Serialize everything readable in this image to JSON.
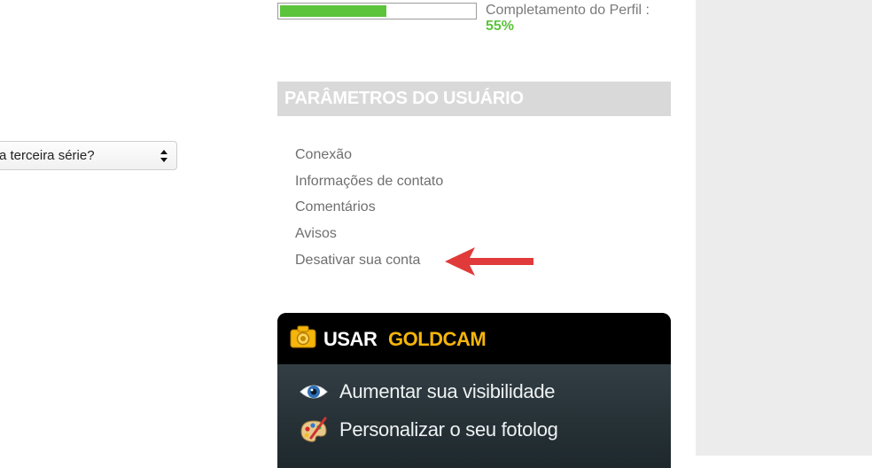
{
  "question_select": {
    "selected": "a terceira série?"
  },
  "profile": {
    "completion_label": "Completamento do Perfil :",
    "completion_value": "55%",
    "completion_fraction": 0.55,
    "bar_color": "#5cc43b"
  },
  "settings": {
    "title": "PARÂMETROS DO USUÁRIO",
    "items": [
      {
        "label": "Conexão"
      },
      {
        "label": "Informações de contato"
      },
      {
        "label": "Comentários"
      },
      {
        "label": "Avisos"
      },
      {
        "label": "Desativar sua conta"
      }
    ]
  },
  "goldcam": {
    "title_white": "USAR",
    "title_gold": "GOLDCAM",
    "accent": "#f5b50a",
    "items": [
      {
        "label": "Aumentar sua visibilidade",
        "icon": "eye-icon"
      },
      {
        "label": "Personalizar o seu fotolog",
        "icon": "palette-icon"
      }
    ]
  },
  "annotation": {
    "arrow_color": "#e03a3a"
  }
}
